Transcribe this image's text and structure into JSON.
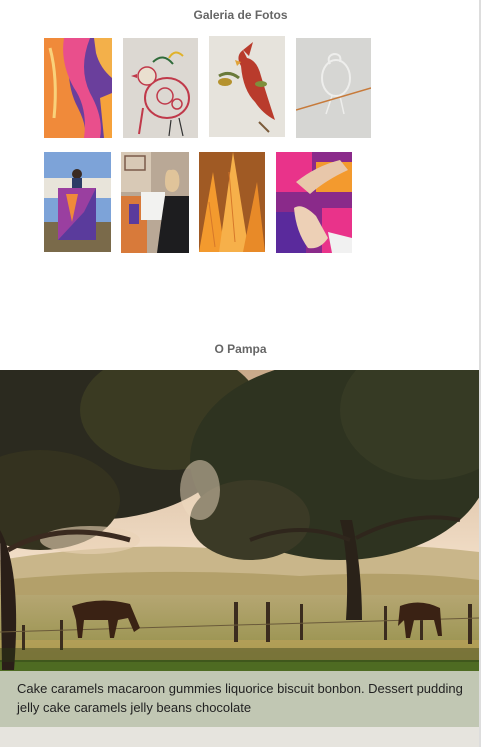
{
  "gallery": {
    "title": "Galeria de Fotos",
    "photos": [
      {
        "subject": "purple-orange quilt"
      },
      {
        "subject": "embroidered bird"
      },
      {
        "subject": "cardinal embroidery"
      },
      {
        "subject": "white stitched bird"
      },
      {
        "subject": "person holding quilt"
      },
      {
        "subject": "woman sewing"
      },
      {
        "subject": "orange textile detail"
      },
      {
        "subject": "hands on colorful fabric"
      }
    ]
  },
  "pampa": {
    "title": "O Pampa",
    "caption": "Cake caramels macaroon gummies liquorice biscuit bonbon. Dessert pudding jelly cake caramels jelly beans chocolate"
  },
  "colors": {
    "title_text": "#666666",
    "caption_bg": "#e1e1dc",
    "caption_text": "#222222"
  }
}
